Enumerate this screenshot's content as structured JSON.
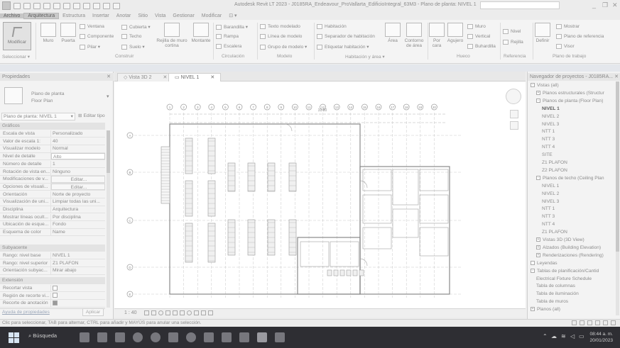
{
  "titlebar": {
    "title": "Autodesk Revit LT 2023 - J0185RA_Endeavour_ProVallarta_EdificioIntegral_63M3 - Plano de planta: NIVEL 1",
    "minimize": "_",
    "restore": "❐",
    "close": "✕"
  },
  "menu": {
    "items": [
      "Archivo",
      "Arquitectura",
      "Estructura",
      "Insertar",
      "Anotar",
      "Sitio",
      "Vista",
      "Gestionar",
      "Modificar"
    ],
    "active": "Arquitectura"
  },
  "ribbon": {
    "modify": "Modificar",
    "select_group": "Seleccionar ▾",
    "build": {
      "muro": "Muro",
      "puerta": "Puerta",
      "ventana": "Ventana",
      "componente": "Componente",
      "pilar": "Pilar ▾",
      "cubierta": "Cubierta ▾",
      "techo": "Techo",
      "suelo": "Suelo ▾",
      "rejilla": "Rejilla de muro cortina",
      "montante": "Montante",
      "group": "Construir"
    },
    "circulation": {
      "barandilla": "Barandilla ▾",
      "rampa": "Rampa",
      "escalera": "Escalera",
      "group": "Circulación"
    },
    "model": {
      "texto": "Texto modelado",
      "linea": "Línea de modelo",
      "grupo": "Grupo de modelo ▾",
      "group": "Modelo"
    },
    "room": {
      "habitacion": "Habitación",
      "separador": "Separador de habitación",
      "etiquetar": "Etiquetar habitación ▾",
      "area": "Área",
      "contorno": "Contorno de área",
      "group": "Habitación y área ▾"
    },
    "opening": {
      "por_cara": "Por cara",
      "agujero": "Agujero",
      "muro": "Muro",
      "vertical": "Vertical",
      "buhardilla": "Buhardilla",
      "group": "Hueco"
    },
    "reference": {
      "nivel": "Nivel",
      "rejilla": "Rejilla",
      "group": "Referencia"
    },
    "workplane": {
      "definir": "Definir",
      "mostrar": "Mostrar",
      "plano_ref": "Plano de referencia",
      "visor": "Visor",
      "group": "Plano de trabajo"
    }
  },
  "properties": {
    "header": "Propiedades",
    "type_line1": "Plano de planta",
    "type_line2": "Floor Plan",
    "selector": "Plano de planta: NIVEL 1",
    "edit_type": "Editar tipo",
    "groups": {
      "graficos": "Gráficos",
      "subyacente": "Subyacente",
      "extension": "Extensión"
    },
    "rows": [
      {
        "k": "Escala de vista",
        "v": "Personalizado"
      },
      {
        "k": "Valor de escala   1:",
        "v": "40"
      },
      {
        "k": "Visualizar modelo",
        "v": "Normal"
      },
      {
        "k": "Nivel de detalle",
        "v": "Alto"
      },
      {
        "k": "Número de detalle",
        "v": "1"
      },
      {
        "k": "Rotación de vista en...",
        "v": "Ninguno"
      },
      {
        "k": "Modificaciones de v...",
        "v": "Editar..."
      },
      {
        "k": "Opciones de visuali...",
        "v": "Editar..."
      },
      {
        "k": "Orientación",
        "v": "Norte de proyecto"
      },
      {
        "k": "Visualización de uni...",
        "v": "Limpiar todas las uni..."
      },
      {
        "k": "Disciplina",
        "v": "Arquitectura"
      },
      {
        "k": "Mostrar líneas ocult...",
        "v": "Por disciplina"
      },
      {
        "k": "Ubicación de esque...",
        "v": "Fondo"
      },
      {
        "k": "Esquema de color",
        "v": "Name"
      }
    ],
    "rows2": [
      {
        "k": "Rango: nivel base",
        "v": "NIVEL 1"
      },
      {
        "k": "Rango: nivel superior",
        "v": "Z1 PLAFON"
      },
      {
        "k": "Orientación subyac...",
        "v": "Mirar abajo"
      }
    ],
    "rows3": [
      {
        "k": "Recortar vista",
        "checked": false
      },
      {
        "k": "Región de recorte vi...",
        "checked": false
      },
      {
        "k": "Recorte de anotación",
        "checked": true
      }
    ],
    "help": "Ayuda de propiedades",
    "apply": "Aplicar"
  },
  "tabs": [
    {
      "label": "Vista 3D 2",
      "active": false
    },
    {
      "label": "NIVEL 1",
      "active": true
    }
  ],
  "viewbar": {
    "scale": "1 : 40"
  },
  "drawing": {
    "grid_labels": [
      "1",
      "2",
      "3",
      "4",
      "5",
      "6",
      "7",
      "8",
      "9",
      "10",
      "11",
      "12",
      "13",
      "14",
      "15",
      "16",
      "17",
      "18",
      "19",
      "20"
    ],
    "row_labels": [
      "A",
      "B",
      "C",
      "D",
      "E"
    ],
    "dimension_label": "31.80"
  },
  "browser": {
    "header": "Navegador de proyectos - J0185RA...",
    "items": [
      {
        "label": "Vistas (all)",
        "level": 0,
        "toggle": "-"
      },
      {
        "label": "Planos estructurales (Structur",
        "level": 1,
        "toggle": "+"
      },
      {
        "label": "Planos de planta (Floor Plan)",
        "level": 1,
        "toggle": "-"
      },
      {
        "label": "NIVEL 1",
        "level": 2,
        "selected": true
      },
      {
        "label": "NIVEL 2",
        "level": 2
      },
      {
        "label": "NIVEL 3",
        "level": 2
      },
      {
        "label": "NTT 1",
        "level": 2
      },
      {
        "label": "NTT 3",
        "level": 2
      },
      {
        "label": "NTT 4",
        "level": 2
      },
      {
        "label": "SITE",
        "level": 2
      },
      {
        "label": "Z1 PLAFON",
        "level": 2
      },
      {
        "label": "Z2 PLAFON",
        "level": 2
      },
      {
        "label": "Planos de techo (Ceiling Plan",
        "level": 1,
        "toggle": "-"
      },
      {
        "label": "NIVEL 1",
        "level": 2
      },
      {
        "label": "NIVEL 2",
        "level": 2
      },
      {
        "label": "NIVEL 3",
        "level": 2
      },
      {
        "label": "NTT 1",
        "level": 2
      },
      {
        "label": "NTT 3",
        "level": 2
      },
      {
        "label": "NTT 4",
        "level": 2
      },
      {
        "label": "Z1 PLAFON",
        "level": 2
      },
      {
        "label": "Vistas 3D (3D View)",
        "level": 1,
        "toggle": "+"
      },
      {
        "label": "Alzados (Building Elevation)",
        "level": 1,
        "toggle": "+"
      },
      {
        "label": "Renderizaciones (Rendering)",
        "level": 1,
        "toggle": "+"
      },
      {
        "label": "Leyendas",
        "level": 0
      },
      {
        "label": "Tablas de planificación/Cantid",
        "level": 0,
        "toggle": "-"
      },
      {
        "label": "Electrical Fixture Schedule",
        "level": 1
      },
      {
        "label": "Tabla de columnas",
        "level": 1
      },
      {
        "label": "Tabla de iluminación",
        "level": 1
      },
      {
        "label": "Tabla de muros",
        "level": 1
      },
      {
        "label": "Planos (all)",
        "level": 0,
        "toggle": "+"
      }
    ]
  },
  "status": "Clic para seleccionar, TAB para alternar, CTRL para añadir y MAYÚS para anular una selección.",
  "taskbar": {
    "search": "Búsqueda",
    "time": "08:44 a. m.",
    "date": "20/01/2023"
  }
}
